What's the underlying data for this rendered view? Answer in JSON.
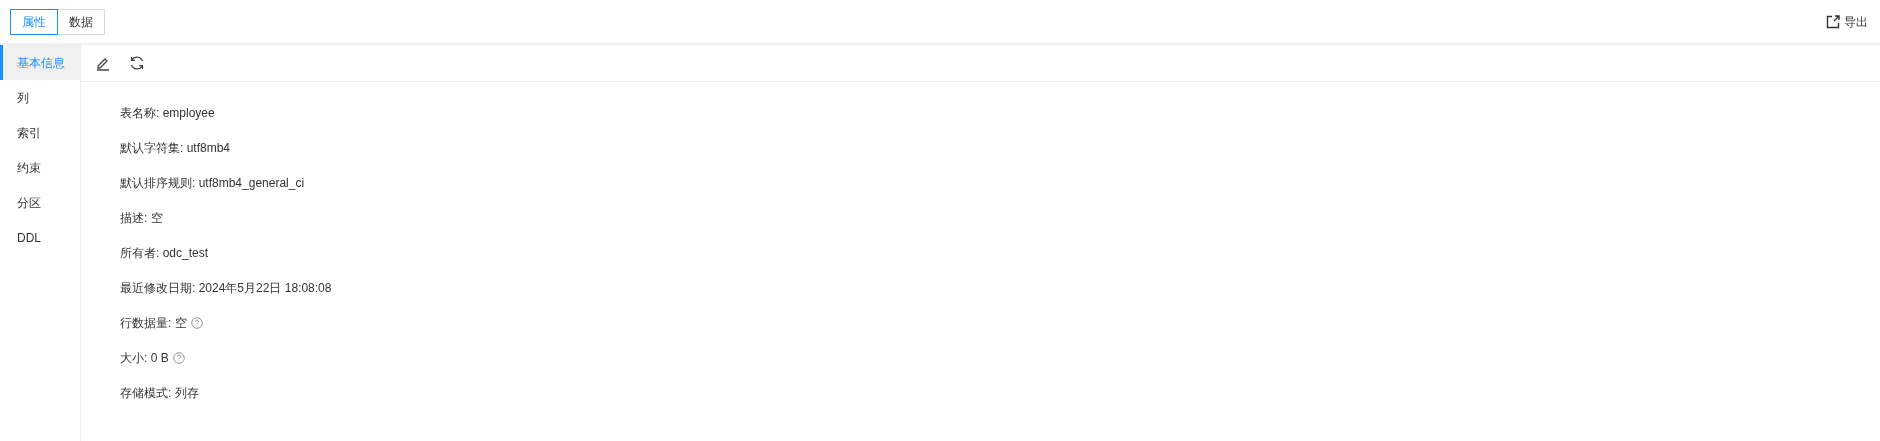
{
  "top_tabs": [
    {
      "label": "属性",
      "selected": true
    },
    {
      "label": "数据",
      "selected": false
    }
  ],
  "export_button": {
    "label": "导出"
  },
  "sidebar": {
    "items": [
      {
        "label": "基本信息",
        "selected": true
      },
      {
        "label": "列",
        "selected": false
      },
      {
        "label": "索引",
        "selected": false
      },
      {
        "label": "约束",
        "selected": false
      },
      {
        "label": "分区",
        "selected": false
      },
      {
        "label": "DDL",
        "selected": false
      }
    ]
  },
  "properties": [
    {
      "label": "表名称:",
      "value": "employee",
      "help": false
    },
    {
      "label": "默认字符集:",
      "value": "utf8mb4",
      "help": false
    },
    {
      "label": "默认排序规则:",
      "value": "utf8mb4_general_ci",
      "help": false
    },
    {
      "label": "描述:",
      "value": "空",
      "help": false
    },
    {
      "label": "所有者:",
      "value": "odc_test",
      "help": false
    },
    {
      "label": "最近修改日期:",
      "value": "2024年5月22日 18:08:08",
      "help": false
    },
    {
      "label": "行数据量:",
      "value": "空",
      "help": true
    },
    {
      "label": "大小:",
      "value": "0 B",
      "help": true
    },
    {
      "label": "存储模式:",
      "value": "列存",
      "help": false
    }
  ]
}
